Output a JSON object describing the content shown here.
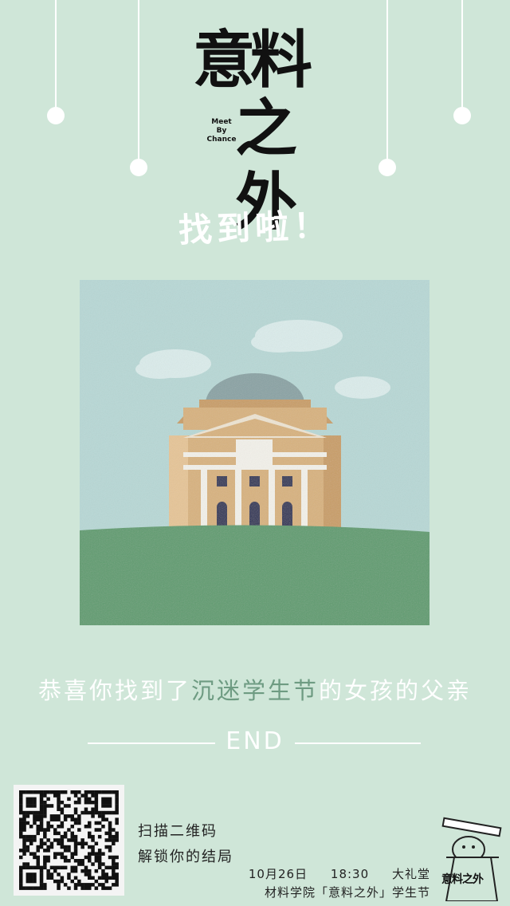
{
  "logo": {
    "cn_line1": "意料",
    "cn_line2": "之外",
    "en_line1": "Meet",
    "en_line2": "By",
    "en_line3": "Chance"
  },
  "title": "找到啦！",
  "message": {
    "prefix": "恭喜你找到了",
    "highlight": "沉迷学生节",
    "suffix": "的女孩的父亲"
  },
  "end_label": "END",
  "qr": {
    "line1": "扫描二维码",
    "line2": "解锁你的结局"
  },
  "event": {
    "date": "10月26日",
    "time": "18:30",
    "venue": "大礼堂",
    "name": "材料学院「意料之外」学生节"
  },
  "mascot_label": "意料之外",
  "colors": {
    "background": "#cfe6d8",
    "sky": "#b8d8d6",
    "grass": "#5f9c70",
    "building": "#d8b27e",
    "highlight_text": "#6e9b82"
  }
}
